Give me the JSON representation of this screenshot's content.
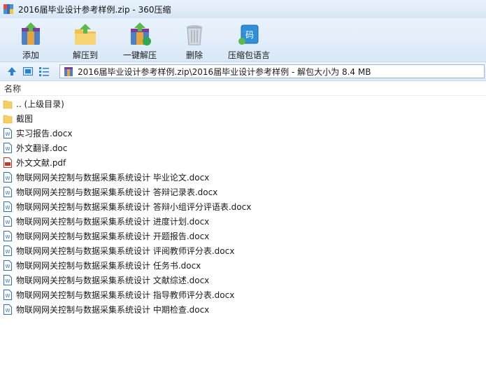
{
  "window": {
    "title": "2016届毕业设计参考样例.zip - 360压缩"
  },
  "toolbar": {
    "add": "添加",
    "extract_to": "解压到",
    "one_click_extract": "一键解压",
    "delete": "删除",
    "archive_language": "压缩包语言"
  },
  "address": {
    "path": "2016届毕业设计参考样例.zip\\2016届毕业设计参考样例 - 解包大小为 8.4 MB"
  },
  "list": {
    "column_name": "名称",
    "items": [
      {
        "name": ".. (上级目录)",
        "icon": "folder-icon"
      },
      {
        "name": "截图",
        "icon": "folder-icon"
      },
      {
        "name": "实习报告.docx",
        "icon": "word-doc-icon"
      },
      {
        "name": "外文翻译.doc",
        "icon": "word-doc-icon"
      },
      {
        "name": "外文文献.pdf",
        "icon": "pdf-icon"
      },
      {
        "name": "物联网网关控制与数据采集系统设计 毕业论文.docx",
        "icon": "word-doc-icon"
      },
      {
        "name": "物联网网关控制与数据采集系统设计 答辩记录表.docx",
        "icon": "word-doc-icon"
      },
      {
        "name": "物联网网关控制与数据采集系统设计 答辩小组评分评语表.docx",
        "icon": "word-doc-icon"
      },
      {
        "name": "物联网网关控制与数据采集系统设计 进度计划.docx",
        "icon": "word-doc-icon"
      },
      {
        "name": "物联网网关控制与数据采集系统设计 开题报告.docx",
        "icon": "word-doc-icon"
      },
      {
        "name": "物联网网关控制与数据采集系统设计 评阅教师评分表.docx",
        "icon": "word-doc-icon"
      },
      {
        "name": "物联网网关控制与数据采集系统设计 任务书.docx",
        "icon": "word-doc-icon"
      },
      {
        "name": "物联网网关控制与数据采集系统设计 文献综述.docx",
        "icon": "word-doc-icon"
      },
      {
        "name": "物联网网关控制与数据采集系统设计 指导教师评分表.docx",
        "icon": "word-doc-icon"
      },
      {
        "name": "物联网网关控制与数据采集系统设计 中期检查.docx",
        "icon": "word-doc-icon"
      }
    ]
  },
  "colors": {
    "folder": "#f5cf62",
    "word": "#2f6fc0",
    "pdf": "#c7362b",
    "accent": "#2a7fd8"
  }
}
